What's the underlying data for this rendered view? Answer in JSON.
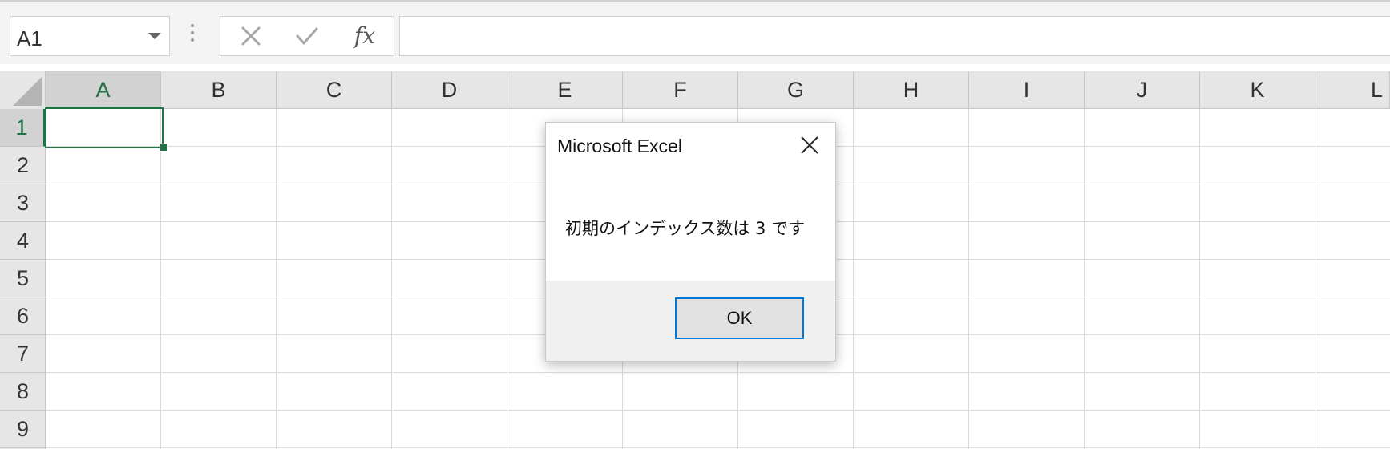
{
  "formula_bar": {
    "name_box_value": "A1",
    "fx_label": "fx",
    "formula_value": ""
  },
  "columns": [
    "A",
    "B",
    "C",
    "D",
    "E",
    "F",
    "G",
    "H",
    "I",
    "J",
    "K",
    "L"
  ],
  "rows": [
    "1",
    "2",
    "3",
    "4",
    "5",
    "6",
    "7",
    "8",
    "9"
  ],
  "selected_cell": "A1",
  "dialog": {
    "title": "Microsoft Excel",
    "message": "初期のインデックス数は 3 です",
    "ok_label": "OK"
  },
  "colors": {
    "accent_green": "#217346",
    "dialog_button_focus": "#0078d7"
  },
  "icons": {
    "name_box_dropdown": "chevron-down-icon",
    "cancel": "close-icon",
    "enter": "check-icon",
    "insert_function": "fx-icon",
    "dialog_close": "close-icon"
  }
}
